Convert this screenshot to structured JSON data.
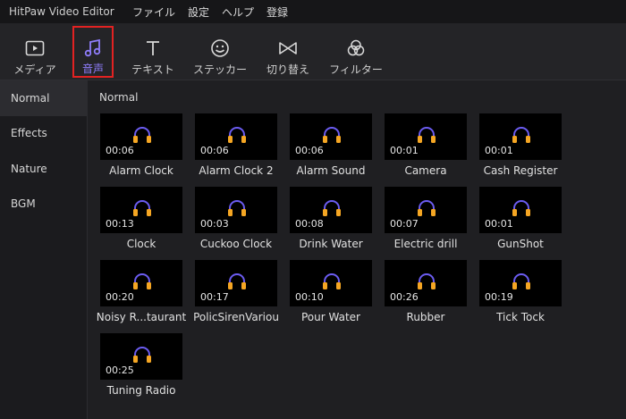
{
  "app_title": "HitPaw Video Editor",
  "menu": [
    "ファイル",
    "設定",
    "ヘルプ",
    "登録"
  ],
  "toolbar": {
    "tools": [
      {
        "label": "メディア",
        "icon": "media-icon"
      },
      {
        "label": "音声",
        "icon": "music-note-icon",
        "active": true
      },
      {
        "label": "テキスト",
        "icon": "text-icon"
      },
      {
        "label": "ステッカー",
        "icon": "sticker-icon"
      },
      {
        "label": "切り替え",
        "icon": "transition-icon"
      },
      {
        "label": "フィルター",
        "icon": "filter-icon"
      }
    ]
  },
  "sidebar": {
    "categories": [
      "Normal",
      "Effects",
      "Nature",
      "BGM"
    ],
    "selected": "Normal"
  },
  "content": {
    "section_title": "Normal",
    "headset_color": "#f5a623",
    "headset_band_color": "#6b5cf0",
    "sounds": [
      {
        "name": "Alarm Clock",
        "duration": "00:06"
      },
      {
        "name": "Alarm Clock 2",
        "duration": "00:06"
      },
      {
        "name": "Alarm Sound",
        "duration": "00:06"
      },
      {
        "name": "Camera",
        "duration": "00:01"
      },
      {
        "name": "Cash Register",
        "duration": "00:01"
      },
      {
        "name": "Clock",
        "duration": "00:13"
      },
      {
        "name": "Cuckoo Clock",
        "duration": "00:03"
      },
      {
        "name": "Drink Water",
        "duration": "00:08"
      },
      {
        "name": "Electric drill",
        "duration": "00:07"
      },
      {
        "name": "GunShot",
        "duration": "00:01"
      },
      {
        "name": "Noisy R...taurant",
        "duration": "00:20"
      },
      {
        "name": "PolicSirenVariou",
        "duration": "00:17"
      },
      {
        "name": "Pour Water",
        "duration": "00:10"
      },
      {
        "name": "Rubber",
        "duration": "00:26"
      },
      {
        "name": "Tick Tock",
        "duration": "00:19"
      },
      {
        "name": "Tuning Radio",
        "duration": "00:25"
      }
    ]
  }
}
